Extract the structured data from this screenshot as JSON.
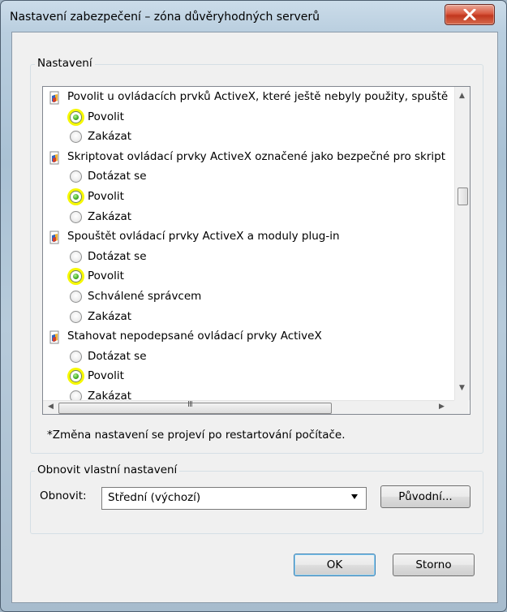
{
  "window": {
    "title": "Nastavení zabezpečení – zóna důvěryhodných serverů",
    "close_glyph": "X"
  },
  "settings_group": {
    "label": "Nastavení",
    "items": [
      {
        "type": "category",
        "label": "Povolit u ovládacích prvků ActiveX, které ještě nebyly použity, spuště"
      },
      {
        "type": "option",
        "label": "Povolit",
        "selected": true
      },
      {
        "type": "option",
        "label": "Zakázat",
        "selected": false
      },
      {
        "type": "category",
        "label": "Skriptovat ovládací prvky ActiveX označené jako bezpečné pro skript"
      },
      {
        "type": "option",
        "label": "Dotázat se",
        "selected": false
      },
      {
        "type": "option",
        "label": "Povolit",
        "selected": true
      },
      {
        "type": "option",
        "label": "Zakázat",
        "selected": false
      },
      {
        "type": "category",
        "label": "Spouštět ovládací prvky ActiveX a moduly plug-in"
      },
      {
        "type": "option",
        "label": "Dotázat se",
        "selected": false
      },
      {
        "type": "option",
        "label": "Povolit",
        "selected": true
      },
      {
        "type": "option",
        "label": "Schválené správcem",
        "selected": false
      },
      {
        "type": "option",
        "label": "Zakázat",
        "selected": false
      },
      {
        "type": "category",
        "label": "Stahovat nepodepsané ovládací prvky ActiveX"
      },
      {
        "type": "option",
        "label": "Dotázat se",
        "selected": false
      },
      {
        "type": "option",
        "label": "Povolit",
        "selected": true
      },
      {
        "type": "option",
        "label": "Zakázat",
        "selected": false
      }
    ],
    "hscroll_grip": "III",
    "note": "*Změna nastavení se projeví po restartování počítače."
  },
  "reset_group": {
    "label": "Obnovit vlastní nastavení",
    "reset_label": "Obnovit:",
    "reset_value": "Střední (výchozí)",
    "reset_button": "Původní..."
  },
  "footer": {
    "ok": "OK",
    "cancel": "Storno"
  },
  "colors": {
    "highlight": "#f6f800",
    "radio_dot": "#3fae22",
    "close_button": "#c2371e"
  },
  "icons": [
    "close-icon",
    "security-setting-icon",
    "scroll-up-arrow-icon",
    "scroll-down-arrow-icon",
    "scroll-left-arrow-icon",
    "scroll-right-arrow-icon",
    "dropdown-arrow-icon"
  ]
}
